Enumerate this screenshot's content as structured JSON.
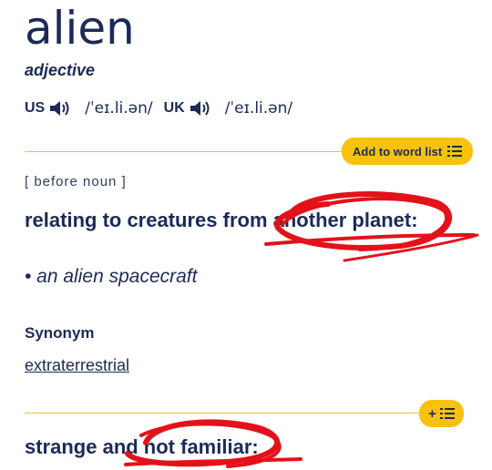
{
  "entry": {
    "headword": "alien",
    "part_of_speech": "adjective",
    "pronunciations": [
      {
        "region": "US",
        "ipa": "/ˈeɪ.li.ən/"
      },
      {
        "region": "UK",
        "ipa": "/ˈeɪ.li.ən/"
      }
    ]
  },
  "buttons": {
    "add_to_word_list": "Add to word list",
    "add_plus": "+"
  },
  "sense1": {
    "grammar": "[ before noun ]",
    "definition": "relating to creatures from another planet:",
    "example": "• an alien spacecraft",
    "synonym_heading": "Synonym",
    "synonym": "extraterrestrial"
  },
  "sense2": {
    "definition": "strange and not familiar:"
  },
  "colors": {
    "text": "#1d2a57",
    "accent_yellow": "#f6c20e",
    "scribble_red": "#e3121a"
  },
  "icons": [
    "speaker-icon",
    "list-icon"
  ]
}
